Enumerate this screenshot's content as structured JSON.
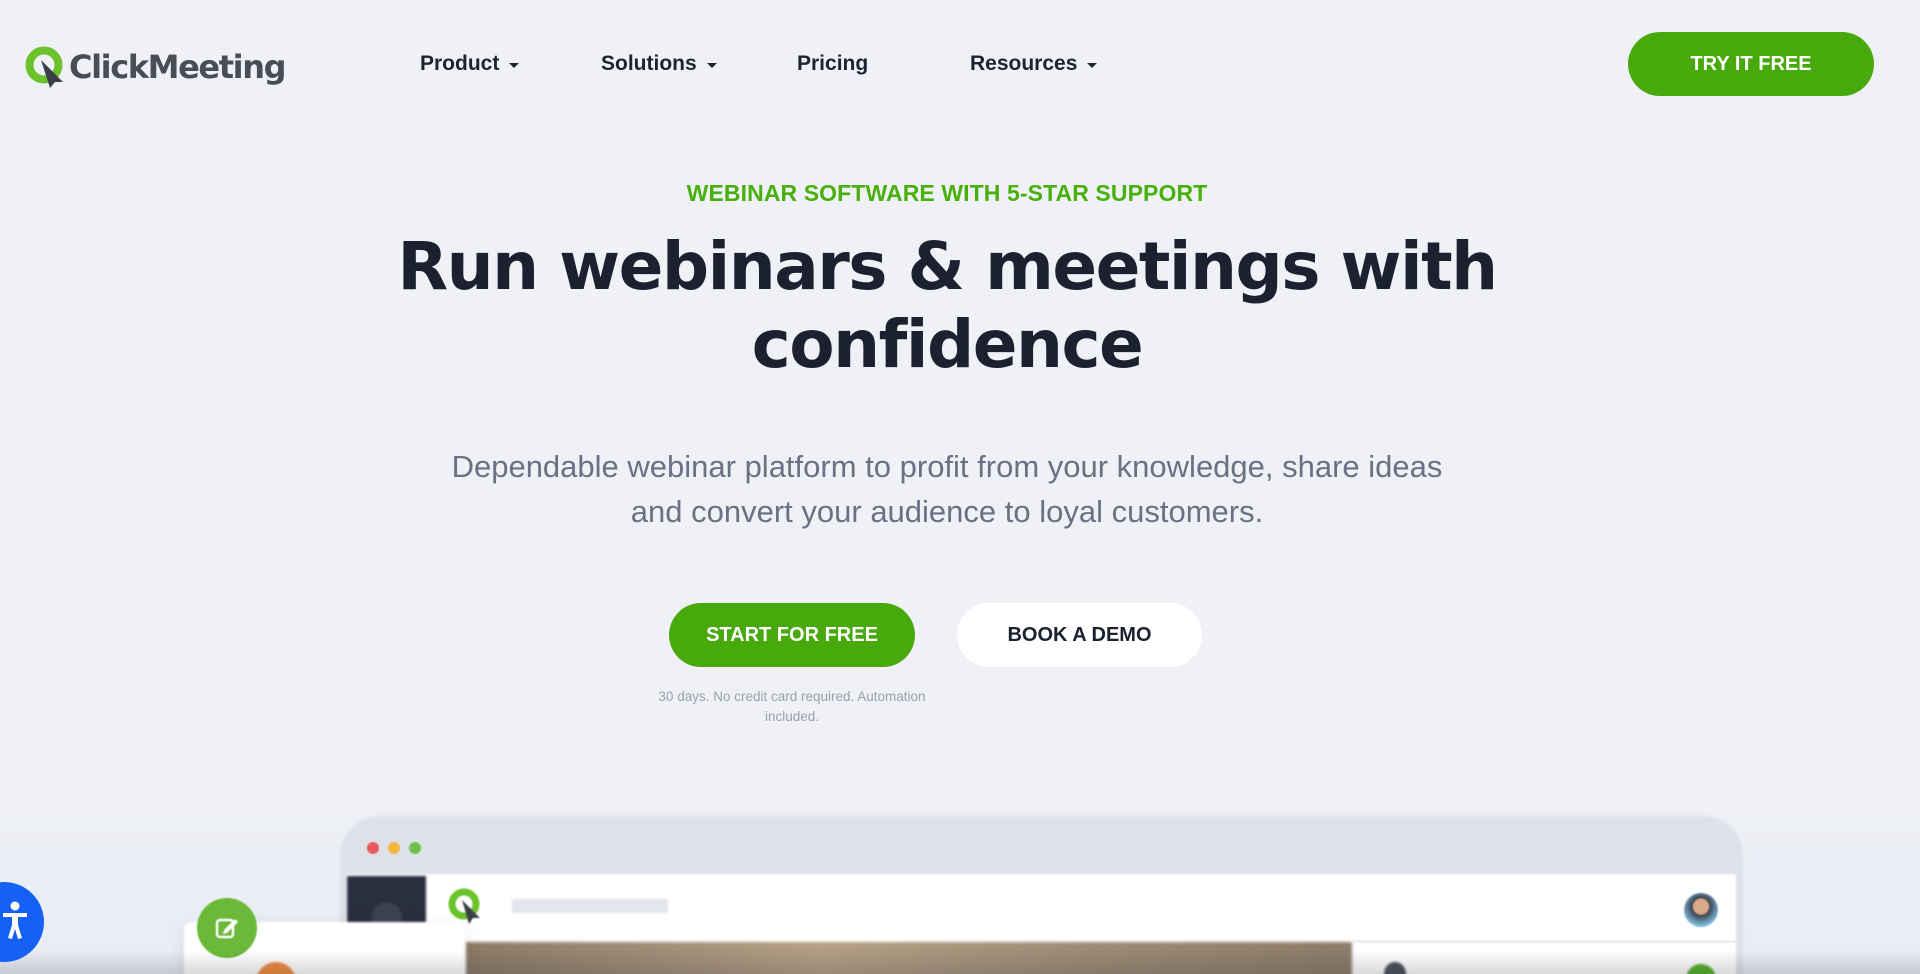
{
  "header": {
    "logo_text": "ClickMeeting",
    "nav": [
      {
        "label": "Product",
        "has_dropdown": true
      },
      {
        "label": "Solutions",
        "has_dropdown": true
      },
      {
        "label": "Pricing",
        "has_dropdown": false
      },
      {
        "label": "Resources",
        "has_dropdown": true
      }
    ],
    "cta_label": "TRY IT FREE"
  },
  "hero": {
    "eyebrow": "WEBINAR SOFTWARE WITH 5-STAR SUPPORT",
    "headline_line1": "Run webinars & meetings with",
    "headline_line2": "confidence",
    "subline_line1": "Dependable webinar platform to profit from your knowledge, share ideas",
    "subline_line2": "and convert your audience to loyal customers.",
    "primary_cta": "START FOR FREE",
    "secondary_cta": "BOOK A DEMO",
    "note_line1": "30 days. No credit card required. Automation",
    "note_line2": "included."
  },
  "colors": {
    "brand_green": "#47a90b",
    "eyebrow_green": "#47b00a",
    "heading": "#1c2130",
    "body": "#6b7184",
    "background": "#eff1f6",
    "accessibility_blue": "#1660f4"
  },
  "icons": {
    "logo": "clickmeeting-logo-icon",
    "dropdown": "chevron-down-icon",
    "accessibility": "accessibility-icon",
    "edit": "edit-icon"
  }
}
